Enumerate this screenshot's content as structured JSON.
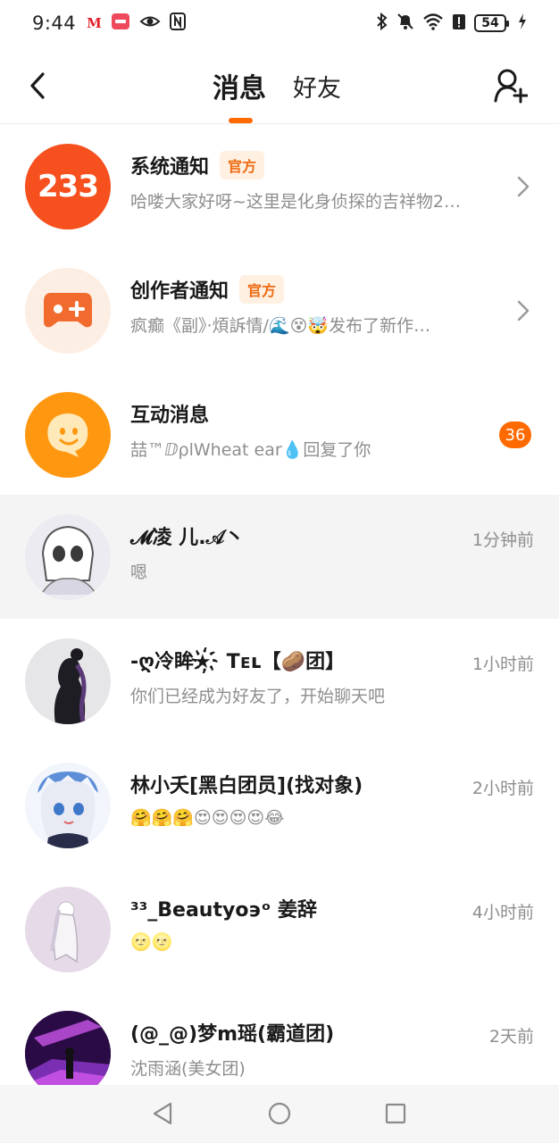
{
  "status_bar": {
    "time": "9:44",
    "battery": "54",
    "left_icons": [
      "app-m-icon",
      "app-red-icon",
      "eye-icon",
      "nfc-icon"
    ],
    "right_icons": [
      "bluetooth-icon",
      "mute-icon",
      "wifi-icon",
      "alert-icon",
      "battery-icon",
      "charging-icon"
    ]
  },
  "header": {
    "tab_active": "消息",
    "tab_inactive": "好友",
    "accent": "#ff6a00"
  },
  "conversations": [
    {
      "title": "系统通知",
      "badge": "官方",
      "subtitle": "哈喽大家好呀~这里是化身侦探的吉祥物2…",
      "avatar_text": "233"
    },
    {
      "title": "创作者通知",
      "badge": "官方",
      "subtitle": "疯癫《副》·煩訴情/🌊😵🤯发布了新作…"
    },
    {
      "title": "互动消息",
      "subtitle": "喆™ⅅρlWheat ear💧回复了你",
      "unread": "36"
    },
    {
      "title": "𝓜凌  儿.𝒜丶",
      "subtitle": "嗯",
      "time": "1分钟前"
    },
    {
      "title": "-ღ冷眸★҉ Tᴇʟ【🥔团】",
      "subtitle": "你们已经成为好友了，开始聊天吧",
      "time": "1小时前"
    },
    {
      "title": "林小夭[黑白团员](找对象)",
      "subtitle": "🤗🤗🤗😍😍😍😍😂",
      "time": "2小时前"
    },
    {
      "title": "³³_Beautyo϶ᵒ 姜辞",
      "subtitle": "🌝🌝",
      "time": "4小时前"
    },
    {
      "title": "(@_@)梦m瑶(霸道团)",
      "subtitle": "沈雨涵(美女团)",
      "time": "2天前"
    }
  ]
}
